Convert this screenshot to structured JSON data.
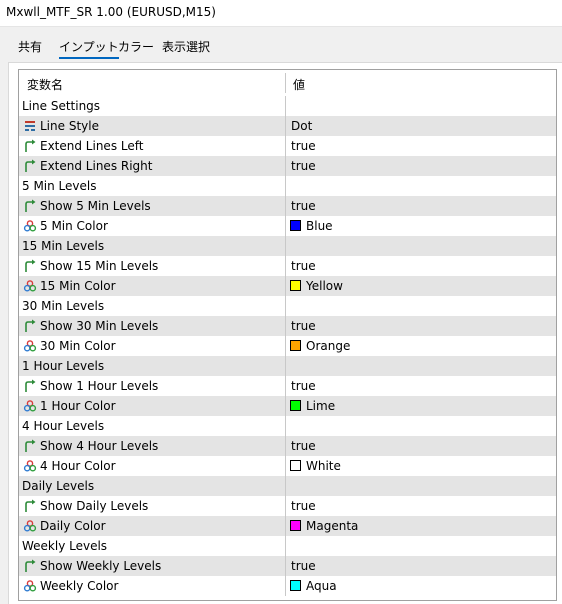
{
  "window": {
    "title": "Mxwll_MTF_SR 1.00 (EURUSD,M15)"
  },
  "tabs": [
    {
      "label": "共有",
      "active": false
    },
    {
      "label": "インプット",
      "active": true
    },
    {
      "label": "カラー",
      "active": false
    },
    {
      "label": "表示選択",
      "active": false
    }
  ],
  "grid": {
    "headers": {
      "name": "変数名",
      "value": "値"
    },
    "rows": [
      {
        "kind": "group",
        "label": "Line Settings"
      },
      {
        "kind": "prop",
        "icon": "line-style-icon",
        "name": "Line Style",
        "value": "Dot"
      },
      {
        "kind": "prop",
        "icon": "bool-arrow-icon",
        "name": "Extend Lines Left",
        "value": "true"
      },
      {
        "kind": "prop",
        "icon": "bool-arrow-icon",
        "name": "Extend Lines Right",
        "value": "true"
      },
      {
        "kind": "group",
        "label": "5 Min Levels"
      },
      {
        "kind": "prop",
        "icon": "bool-arrow-icon",
        "name": "Show 5 Min Levels",
        "value": "true"
      },
      {
        "kind": "color",
        "icon": "color-palette-icon",
        "name": "5 Min Color",
        "value": "Blue",
        "swatch": "#0000ff"
      },
      {
        "kind": "group",
        "label": "15 Min Levels"
      },
      {
        "kind": "prop",
        "icon": "bool-arrow-icon",
        "name": "Show 15 Min Levels",
        "value": "true"
      },
      {
        "kind": "color",
        "icon": "color-palette-icon",
        "name": "15 Min Color",
        "value": "Yellow",
        "swatch": "#ffff00"
      },
      {
        "kind": "group",
        "label": "30 Min Levels"
      },
      {
        "kind": "prop",
        "icon": "bool-arrow-icon",
        "name": "Show 30 Min Levels",
        "value": "true"
      },
      {
        "kind": "color",
        "icon": "color-palette-icon",
        "name": "30 Min Color",
        "value": "Orange",
        "swatch": "#ffa500"
      },
      {
        "kind": "group",
        "label": "1 Hour Levels"
      },
      {
        "kind": "prop",
        "icon": "bool-arrow-icon",
        "name": "Show 1 Hour Levels",
        "value": "true"
      },
      {
        "kind": "color",
        "icon": "color-palette-icon",
        "name": "1 Hour Color",
        "value": "Lime",
        "swatch": "#00ff00"
      },
      {
        "kind": "group",
        "label": "4 Hour Levels"
      },
      {
        "kind": "prop",
        "icon": "bool-arrow-icon",
        "name": "Show 4 Hour Levels",
        "value": "true"
      },
      {
        "kind": "color",
        "icon": "color-palette-icon",
        "name": "4 Hour Color",
        "value": "White",
        "swatch": "#ffffff"
      },
      {
        "kind": "group",
        "label": "Daily Levels"
      },
      {
        "kind": "prop",
        "icon": "bool-arrow-icon",
        "name": "Show Daily Levels",
        "value": "true"
      },
      {
        "kind": "color",
        "icon": "color-palette-icon",
        "name": "Daily Color",
        "value": "Magenta",
        "swatch": "#ff00ff"
      },
      {
        "kind": "group",
        "label": "Weekly Levels"
      },
      {
        "kind": "prop",
        "icon": "bool-arrow-icon",
        "name": "Show Weekly Levels",
        "value": "true"
      },
      {
        "kind": "color",
        "icon": "color-palette-icon",
        "name": "Weekly Color",
        "value": "Aqua",
        "swatch": "#00ffff"
      }
    ]
  }
}
